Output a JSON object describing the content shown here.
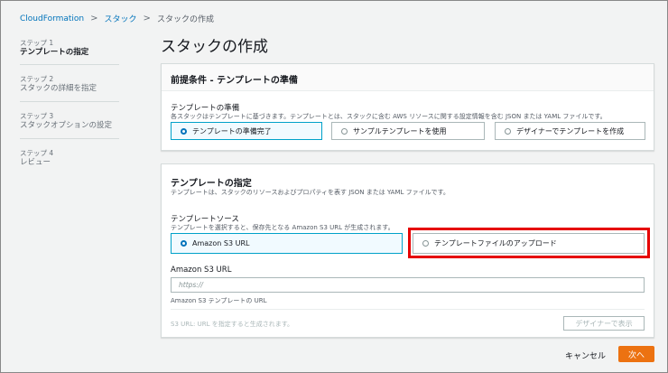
{
  "breadcrumb": {
    "items": [
      "CloudFormation",
      "スタック",
      "スタックの作成"
    ],
    "separator": ">"
  },
  "steps": [
    {
      "num": "ステップ 1",
      "label": "テンプレートの指定",
      "active": true
    },
    {
      "num": "ステップ 2",
      "label": "スタックの詳細を指定",
      "active": false
    },
    {
      "num": "ステップ 3",
      "label": "スタックオプションの設定",
      "active": false
    },
    {
      "num": "ステップ 4",
      "label": "レビュー",
      "active": false
    }
  ],
  "page_title": "スタックの作成",
  "prereq": {
    "title": "前提条件 - テンプレートの準備",
    "label": "テンプレートの準備",
    "description": "各スタックはテンプレートに基づきます。テンプレートとは、スタックに含む AWS リソースに関する設定情報を含む JSON または YAML ファイルです。",
    "options": [
      "テンプレートの準備完了",
      "サンプルテンプレートを使用",
      "デザイナーでテンプレートを作成"
    ],
    "selected": 0
  },
  "template": {
    "title": "テンプレートの指定",
    "description": "テンプレートは、スタックのリソースおよびプロパティを表す JSON または YAML ファイルです。",
    "source_label": "テンプレートソース",
    "source_description": "テンプレートを選択すると、保存先となる Amazon S3 URL が生成されます。",
    "options": [
      "Amazon S3 URL",
      "テンプレートファイルのアップロード"
    ],
    "selected": 0,
    "s3_label": "Amazon S3 URL",
    "s3_placeholder": "https://",
    "s3_hint": "Amazon S3 テンプレートの URL",
    "s3_url_status": "S3 URL:  URL を指定すると生成されます。",
    "designer_button": "デザイナーで表示"
  },
  "footer": {
    "cancel": "キャンセル",
    "next": "次へ"
  },
  "colors": {
    "link": "#0073bb",
    "selected_border": "#00a1c9",
    "primary": "#ec7211",
    "highlight": "#e60000"
  }
}
